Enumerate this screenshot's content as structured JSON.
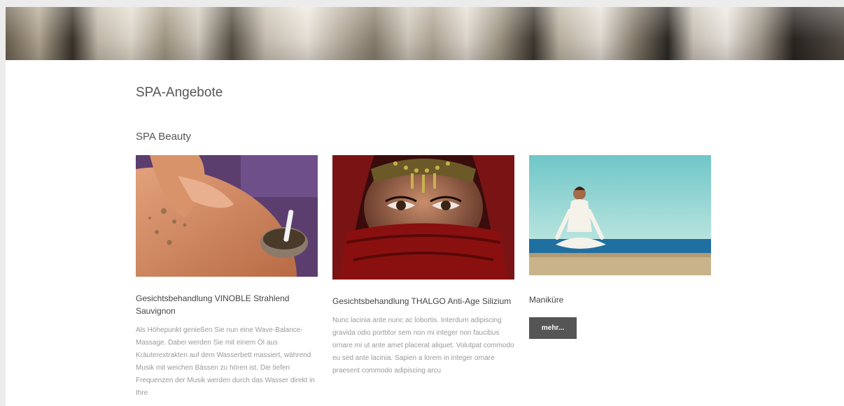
{
  "page": {
    "title": "SPA-Angebote",
    "section_title": "SPA Beauty"
  },
  "cards": [
    {
      "title": "Gesichtsbehandlung VINOBLE Strahlend Sauvignon",
      "description": "Als Höhepunkt genießen Sie nun eine Wave-Balance-Massage. Dabei werden Sie mit einem Öl aus Kräuterextrakten auf dem Wasserbett massiert, während Musik mit weichen Bässen zu hören ist. Die tiefen Frequenzen der Musik werden durch das Wasser direkt in Ihre"
    },
    {
      "title": "Gesichtsbehandlung THALGO Anti-Age Silizium",
      "description": "Nunc lacinia ante nunc ac lobortis. Interdum adipiscing gravida odio porttitor sem non mi integer non faucibus ornare mi ut ante amet placerat aliquet. Volutpat commodo eu sed ante lacinia. Sapien a lorem in integer ornare praesent commodo adipiscing arcu"
    },
    {
      "title": "Maniküre",
      "button_label": "mehr..."
    }
  ],
  "colors": {
    "text_dark": "#555555",
    "text_muted": "#9a9a9a",
    "button_bg": "#555555"
  }
}
